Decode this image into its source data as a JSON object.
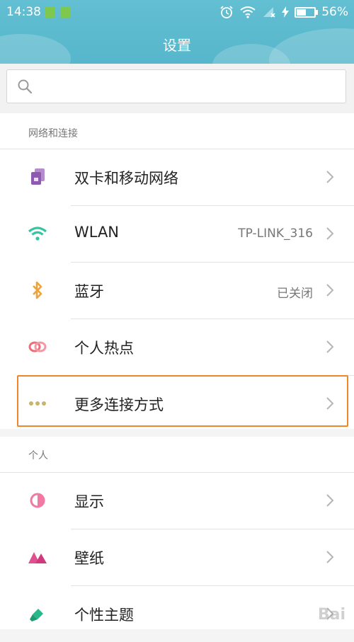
{
  "status_bar": {
    "time": "14:38",
    "battery": "56%",
    "battery_level": 0.56
  },
  "header": {
    "title": "设置"
  },
  "search": {
    "placeholder": "",
    "value": ""
  },
  "sections": [
    {
      "label": "网络和连接"
    },
    {
      "label": "个人"
    }
  ],
  "network_items": [
    {
      "label": "双卡和移动网络",
      "value": "",
      "icon": "sim-cards-icon",
      "color": "#8e5ab0"
    },
    {
      "label": "WLAN",
      "value": "TP-LINK_316",
      "icon": "wifi-icon",
      "color": "#2fc7a4"
    },
    {
      "label": "蓝牙",
      "value": "已关闭",
      "icon": "bluetooth-icon",
      "color": "#f0a23a"
    },
    {
      "label": "个人热点",
      "value": "",
      "icon": "hotspot-icon",
      "color": "#ec6f7b"
    },
    {
      "label": "更多连接方式",
      "value": "",
      "icon": "more-dots-icon",
      "color": "#c8b46a",
      "highlighted": true
    }
  ],
  "personal_items": [
    {
      "label": "显示",
      "icon": "display-icon",
      "color": "#f07aa4"
    },
    {
      "label": "壁纸",
      "icon": "wallpaper-icon",
      "color": "#e0508e"
    },
    {
      "label": "个性主题",
      "icon": "theme-brush-icon",
      "color": "#27b88a"
    }
  ],
  "watermark": "Bai"
}
